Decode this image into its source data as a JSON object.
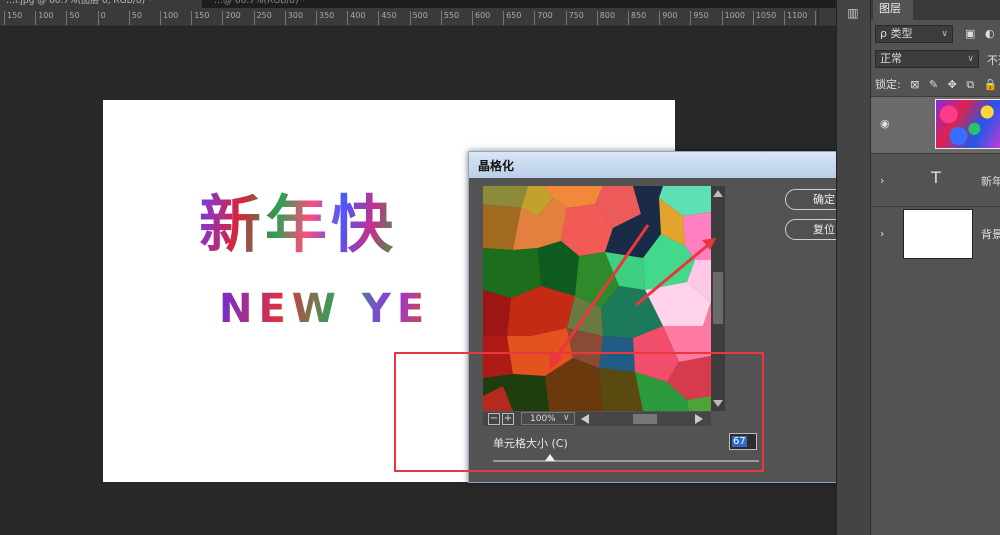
{
  "document_tabs": [
    {
      "label": "…l.jpg @ 60.7%(图层 0, RGB/8) *"
    },
    {
      "label": "…@ 66.7%(RGB/8) *"
    }
  ],
  "ruler_ticks": [
    "150",
    "100",
    "50",
    "0",
    "50",
    "100",
    "150",
    "200",
    "250",
    "300",
    "350",
    "400",
    "450",
    "500",
    "550",
    "600",
    "650",
    "700",
    "750",
    "800",
    "850",
    "900",
    "950",
    "1000",
    "1050",
    "1100",
    "1150",
    "1"
  ],
  "canvas": {
    "title_cn": "新年快",
    "title_en": "NEW YE"
  },
  "dialog": {
    "title": "晶格化",
    "close_glyph": "✕",
    "ok_label": "确定",
    "reset_label": "复位",
    "zoom_out": "−",
    "zoom_in": "+",
    "zoom_value": "100%",
    "zoom_caret": "∨",
    "cell_size_label": "单元格大小 (C)",
    "cell_size_value": "67",
    "cell_size_min": 3,
    "cell_size_max": 300
  },
  "layers_panel": {
    "tab_label": "图层",
    "filter_label": "ρ 类型",
    "filter_caret": "∨",
    "blend_mode": "正常",
    "blend_caret": "∨",
    "opacity_label": "不透",
    "lock_label": "锁定:",
    "layers": [
      {
        "name": "",
        "kind": "image",
        "visible": true
      },
      {
        "name": "新年",
        "kind": "text",
        "visible": true
      },
      {
        "name": "背景",
        "kind": "background",
        "visible": true
      }
    ]
  },
  "icons": {
    "history": "history-icon",
    "eye": "eye-icon",
    "text_layer": "T",
    "image_filter": "▣",
    "adjust_filter": "◐"
  },
  "colors": {
    "accent_red": "#e8383d",
    "dialog_bg": "#535353",
    "workspace_bg": "#282828"
  }
}
